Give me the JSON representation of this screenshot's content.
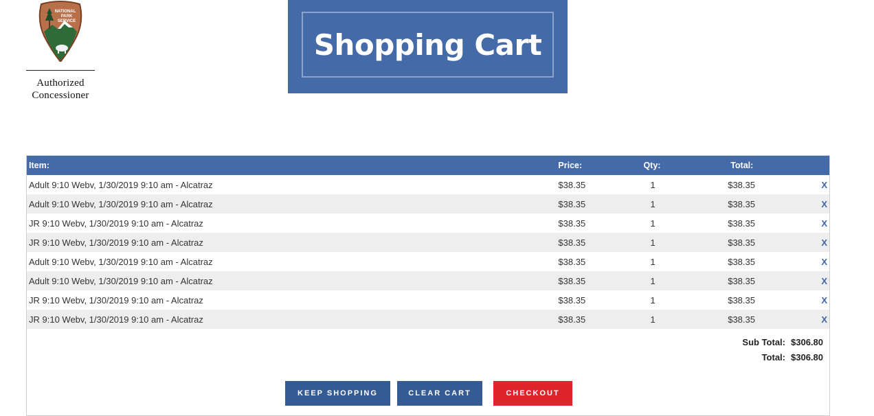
{
  "logo": {
    "seal_text": [
      "NATIONAL",
      "PARK",
      "SERVICE"
    ],
    "caption_line1": "Authorized",
    "caption_line2": "Concessioner"
  },
  "page_title": "Shopping Cart",
  "cart": {
    "headers": {
      "item": "Item:",
      "price": "Price:",
      "qty": "Qty:",
      "total": "Total:"
    },
    "rows": [
      {
        "item": "Adult 9:10 Webv, 1/30/2019 9:10 am - Alcatraz",
        "price": "$38.35",
        "qty": "1",
        "total": "$38.35",
        "remove": "X"
      },
      {
        "item": "Adult 9:10 Webv, 1/30/2019 9:10 am - Alcatraz",
        "price": "$38.35",
        "qty": "1",
        "total": "$38.35",
        "remove": "X"
      },
      {
        "item": "JR 9:10 Webv, 1/30/2019 9:10 am - Alcatraz",
        "price": "$38.35",
        "qty": "1",
        "total": "$38.35",
        "remove": "X"
      },
      {
        "item": "JR 9:10 Webv, 1/30/2019 9:10 am - Alcatraz",
        "price": "$38.35",
        "qty": "1",
        "total": "$38.35",
        "remove": "X"
      },
      {
        "item": "Adult 9:10 Webv, 1/30/2019 9:10 am - Alcatraz",
        "price": "$38.35",
        "qty": "1",
        "total": "$38.35",
        "remove": "X"
      },
      {
        "item": "Adult 9:10 Webv, 1/30/2019 9:10 am - Alcatraz",
        "price": "$38.35",
        "qty": "1",
        "total": "$38.35",
        "remove": "X"
      },
      {
        "item": "JR 9:10 Webv, 1/30/2019 9:10 am - Alcatraz",
        "price": "$38.35",
        "qty": "1",
        "total": "$38.35",
        "remove": "X"
      },
      {
        "item": "JR 9:10 Webv, 1/30/2019 9:10 am - Alcatraz",
        "price": "$38.35",
        "qty": "1",
        "total": "$38.35",
        "remove": "X"
      }
    ],
    "subtotal_label": "Sub Total:",
    "subtotal_value": "$306.80",
    "total_label": "Total:",
    "total_value": "$306.80"
  },
  "buttons": {
    "keep_shopping": "KEEP SHOPPING",
    "clear_cart": "CLEAR CART",
    "checkout": "CHECKOUT"
  },
  "colors": {
    "brand_blue": "#456aa8",
    "button_blue": "#355b95",
    "checkout_red": "#df252c",
    "row_alt": "#eeeeee"
  },
  "icons": {
    "logo": "nps-arrowhead-logo",
    "remove": "remove-x-icon"
  }
}
